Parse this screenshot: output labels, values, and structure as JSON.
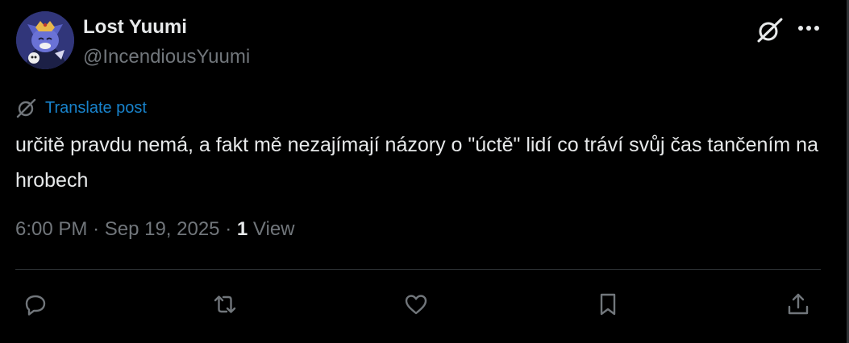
{
  "author": {
    "name": "Lost Yuumi",
    "handle": "@IncendiousYuumi"
  },
  "translate_label": "Translate post",
  "post": {
    "text": "určitě pravdu nemá, a fakt mě nezajímají názory o \"úctě\" lidí co tráví svůj čas tančením na hrobech"
  },
  "meta": {
    "time": "6:00 PM",
    "date": "Sep 19, 2025",
    "separator": "·",
    "views_count": "1",
    "views_label": "View"
  },
  "icons": {
    "grok": "grok-icon",
    "more": "more-icon",
    "translate": "translate-icon",
    "reply": "reply-icon",
    "repost": "repost-icon",
    "like": "like-icon",
    "bookmark": "bookmark-icon",
    "share": "share-icon"
  },
  "colors": {
    "background": "#000000",
    "text_primary": "#e7e9ea",
    "text_secondary": "#71767b",
    "link": "#1d9bf0",
    "divider": "#2f3336"
  }
}
